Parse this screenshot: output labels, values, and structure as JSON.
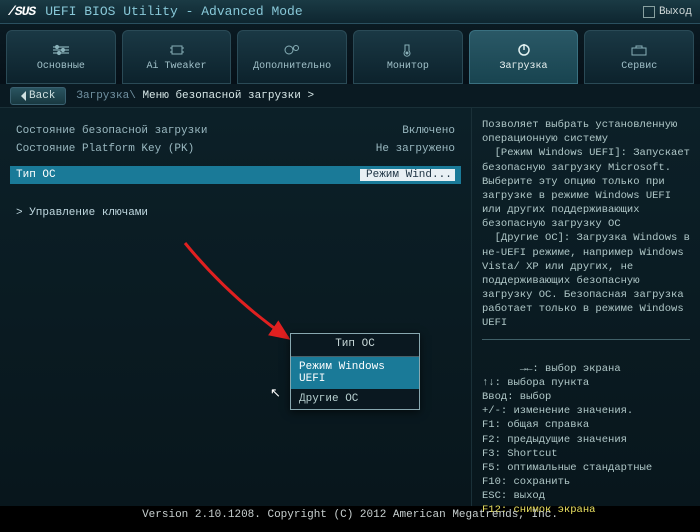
{
  "header": {
    "logo": "/SUS",
    "title": "UEFI BIOS Utility - Advanced Mode",
    "exit": "Выход"
  },
  "tabs": [
    {
      "label": "Основные"
    },
    {
      "label": "Ai Tweaker"
    },
    {
      "label": "Дополнительно"
    },
    {
      "label": "Монитор"
    },
    {
      "label": "Загрузка"
    },
    {
      "label": "Сервис"
    }
  ],
  "back": "Back",
  "breadcrumb": {
    "parent": "Загрузка\\",
    "current": "Меню безопасной загрузки >"
  },
  "rows": [
    {
      "label": "Состояние безопасной загрузки",
      "value": "Включено"
    },
    {
      "label": "Состояние Platform Key (PK)",
      "value": "Не загружено"
    }
  ],
  "selected": {
    "label": "Тип ОС",
    "value": "Режим Wind..."
  },
  "submenu": "Управление ключами",
  "popup": {
    "title": "Тип ОС",
    "options": [
      {
        "label": "Режим Windows UEFI",
        "selected": true
      },
      {
        "label": "Другие ОС",
        "selected": false
      }
    ]
  },
  "help": {
    "desc": "Позволяет выбрать установленную операционную систему\n  [Режим Windows UEFI]: Запускает безопасную загрузку Microsoft. Выберите эту опцию только при загрузке в режиме Windows UEFI или других поддерживающих безопасную загрузку ОС\n  [Другие ОС]: Загрузка Windows в не-UEFI режиме, например Windows Vista/ XP или других, не поддерживающих безопасную загрузку ОС. Безопасная загрузка работает только в режиме Windows UEFI",
    "keys": "→←: выбор экрана\n↑↓: выбора пункта\nВвод: выбор\n+/-: изменение значения.\nF1: общая справка\nF2: предыдущие значения\nF3: Shortcut\nF5: оптимальные стандартные\nF10: сохранить\nESC: выход",
    "f12": "F12: снимок экрана"
  },
  "footer": "Version 2.10.1208. Copyright (C) 2012 American Megatrends, Inc."
}
